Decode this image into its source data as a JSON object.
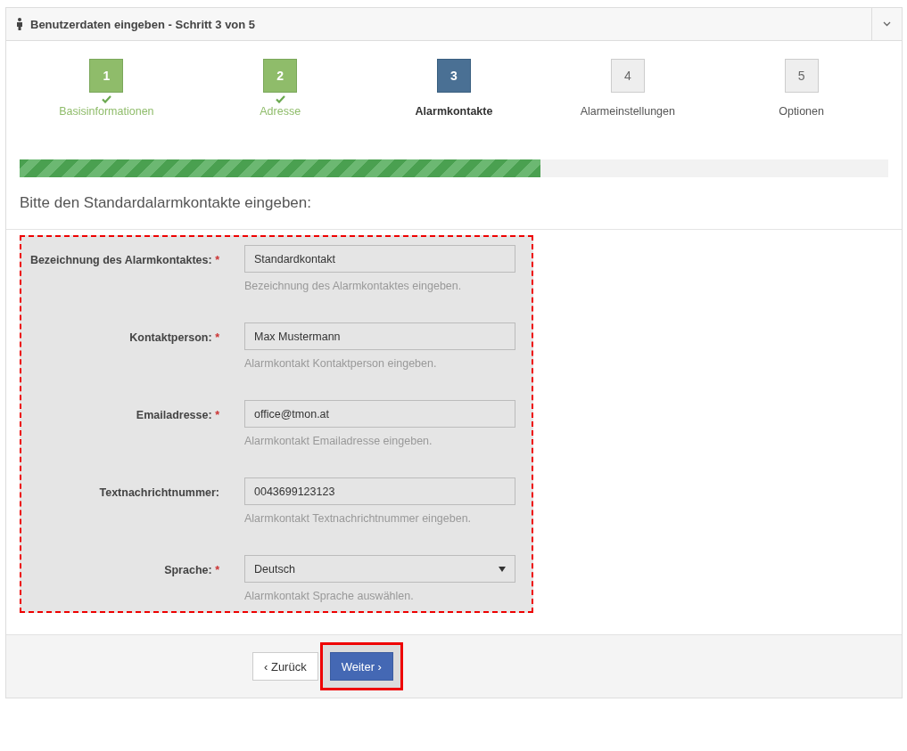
{
  "panel": {
    "title": "Benutzerdaten eingeben - Schritt 3 von 5"
  },
  "steps": [
    {
      "number": "1",
      "label": "Basisinformationen",
      "kind": "done"
    },
    {
      "number": "2",
      "label": "Adresse",
      "kind": "done"
    },
    {
      "number": "3",
      "label": "Alarmkontakte",
      "kind": "active"
    },
    {
      "number": "4",
      "label": "Alarmeinstellungen",
      "kind": "todo"
    },
    {
      "number": "5",
      "label": "Optionen",
      "kind": "todo"
    }
  ],
  "progress": {
    "level": 0.6
  },
  "heading": "Bitte den Standardalarmkontakte eingeben:",
  "fields": [
    {
      "kind": "text",
      "label": "Bezeichnung des Alarmkontaktes:",
      "required_mark": "*",
      "value": "Standardkontakt",
      "help": "Bezeichnung des Alarmkontaktes eingeben."
    },
    {
      "kind": "text",
      "label": "Kontaktperson:",
      "required_mark": "*",
      "value": "Max Mustermann",
      "help": "Alarmkontakt Kontaktperson eingeben."
    },
    {
      "kind": "text",
      "label": "Emailadresse:",
      "required_mark": "*",
      "value": "office@tmon.at",
      "help": "Alarmkontakt Emailadresse eingeben."
    },
    {
      "kind": "text",
      "label": "Textnachrichtnummer:",
      "value": "0043699123123",
      "help": "Alarmkontakt Textnachrichtnummer eingeben."
    },
    {
      "kind": "select",
      "label": "Sprache:",
      "required_mark": "*",
      "value": "Deutsch",
      "help": "Alarmkontakt Sprache auswählen."
    }
  ],
  "buttons": [
    {
      "label": "‹ Zurück",
      "kind": "default"
    },
    {
      "label": "Weiter ›",
      "kind": "primary"
    }
  ]
}
